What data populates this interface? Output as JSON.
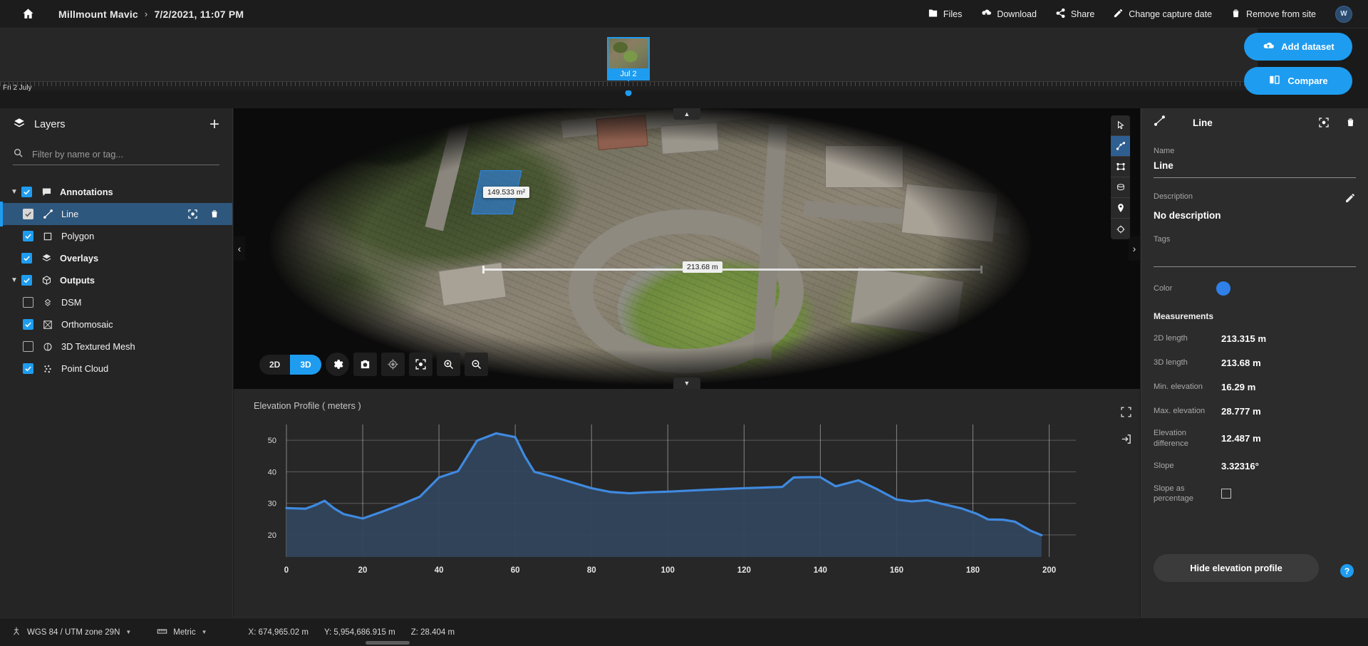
{
  "topbar": {
    "home_icon": "home-icon",
    "site_name": "Millmount Mavic",
    "separator": "›",
    "capture_date": "7/2/2021, 11:07 PM",
    "actions": [
      {
        "label": "Files",
        "icon": "folder-icon"
      },
      {
        "label": "Download",
        "icon": "cloud-download-icon"
      },
      {
        "label": "Share",
        "icon": "share-icon"
      },
      {
        "label": "Change capture date",
        "icon": "pencil-icon"
      },
      {
        "label": "Remove from site",
        "icon": "trash-icon"
      }
    ],
    "avatar_initial": "W"
  },
  "side_actions": {
    "add_dataset": "Add dataset",
    "compare": "Compare"
  },
  "timeline": {
    "range_label": "Fri 2 July",
    "datasets": [
      {
        "label": "Jul 2",
        "selected": true
      }
    ]
  },
  "sidebar": {
    "title": "Layers",
    "add_label": "+",
    "search_placeholder": "Filter by name or tag...",
    "search_value": "",
    "items": [
      {
        "label": "Annotations",
        "icon": "annotation-icon",
        "checked": true,
        "expandable": true,
        "expanded": true,
        "indent": 0,
        "bold": true
      },
      {
        "label": "Line",
        "icon": "line-icon",
        "checked": true,
        "expandable": false,
        "indent": 2,
        "selected": true,
        "bold": false,
        "actions": [
          "focus-icon",
          "trash-icon"
        ]
      },
      {
        "label": "Polygon",
        "icon": "polygon-icon",
        "checked": true,
        "expandable": false,
        "indent": 2,
        "bold": false
      },
      {
        "label": "Overlays",
        "icon": "layers-icon",
        "checked": true,
        "expandable": false,
        "indent": 1,
        "bold": true
      },
      {
        "label": "Outputs",
        "icon": "cube-icon",
        "checked": true,
        "expandable": true,
        "expanded": true,
        "indent": 0,
        "bold": true
      },
      {
        "label": "DSM",
        "icon": "dsm-icon",
        "checked": false,
        "expandable": false,
        "indent": 2,
        "bold": false
      },
      {
        "label": "Orthomosaic",
        "icon": "ortho-icon",
        "checked": true,
        "expandable": false,
        "indent": 2,
        "bold": false
      },
      {
        "label": "3D Textured Mesh",
        "icon": "mesh-icon",
        "checked": false,
        "expandable": false,
        "indent": 2,
        "bold": false
      },
      {
        "label": "Point Cloud",
        "icon": "pointcloud-icon",
        "checked": true,
        "expandable": false,
        "indent": 2,
        "bold": false
      }
    ]
  },
  "viewport": {
    "area_label": "149.533 m²",
    "distance_label": "213.68 m",
    "toolbar": {
      "mode_2d": "2D",
      "mode_3d": "3D",
      "active_mode": "3D",
      "buttons": [
        {
          "icon": "gear-icon"
        },
        {
          "icon": "camera-icon"
        },
        {
          "icon": "target-icon"
        },
        {
          "icon": "fit-view-icon"
        },
        {
          "icon": "zoom-in-icon"
        },
        {
          "icon": "zoom-out-icon"
        }
      ]
    },
    "tool_palette": [
      {
        "icon": "cursor-icon",
        "active": false
      },
      {
        "icon": "line-tool-icon",
        "active": true
      },
      {
        "icon": "polygon-tool-icon",
        "active": false
      },
      {
        "icon": "volume-tool-icon",
        "active": false
      },
      {
        "icon": "marker-tool-icon",
        "active": false
      },
      {
        "icon": "circle-tool-icon",
        "active": false
      }
    ]
  },
  "profile": {
    "title": "Elevation Profile ( meters )",
    "icons": [
      "expand-icon",
      "export-icon"
    ]
  },
  "chart_data": {
    "type": "area",
    "title": "Elevation Profile ( meters )",
    "xlabel": "",
    "ylabel": "",
    "xlim": [
      0,
      207
    ],
    "ylim": [
      13,
      55
    ],
    "xticks": [
      0,
      20,
      40,
      60,
      80,
      100,
      120,
      140,
      160,
      180,
      200
    ],
    "yticks": [
      20,
      30,
      40,
      50
    ],
    "grid": true,
    "legend": "none",
    "line_color": "#3f8ae0",
    "fill_color": "#32445c",
    "x": [
      0,
      2.5,
      5,
      7.5,
      10,
      12.5,
      15,
      17.5,
      20,
      25,
      30,
      35,
      40,
      45,
      50,
      55,
      60,
      62.5,
      65,
      70,
      75,
      80,
      85,
      90,
      95,
      100,
      110,
      120,
      125,
      130,
      133,
      137,
      140,
      144,
      150,
      155,
      160,
      164,
      168,
      172,
      177,
      181,
      184,
      188,
      191,
      195,
      198
    ],
    "y": [
      28.5,
      28.4,
      28.3,
      29.4,
      30.8,
      28.4,
      26.6,
      25.9,
      25.2,
      27.3,
      29.6,
      32.1,
      38.2,
      40.2,
      49.9,
      52.2,
      51.0,
      44.9,
      40.0,
      38.4,
      36.6,
      34.8,
      33.6,
      33.2,
      33.5,
      33.7,
      34.3,
      34.8,
      35.0,
      35.2,
      38.2,
      38.3,
      38.3,
      35.4,
      37.3,
      34.4,
      31.2,
      30.6,
      31.0,
      29.8,
      28.4,
      26.7,
      24.9,
      24.8,
      24.2,
      21.4,
      19.9
    ]
  },
  "right_panel": {
    "header_title": "Line",
    "header_icon": "line-icon",
    "header_actions": [
      "focus-icon",
      "trash-icon"
    ],
    "name_label": "Name",
    "name_value": "Line",
    "description_label": "Description",
    "description_value": "No description",
    "description_edit_icon": "pencil-icon",
    "tags_label": "Tags",
    "tags_value": "",
    "color_label": "Color",
    "color_value": "#2f80e8",
    "measurements_title": "Measurements",
    "measurements": [
      {
        "label": "2D length",
        "value": "213.315 m"
      },
      {
        "label": "3D length",
        "value": "213.68 m"
      },
      {
        "label": "Min. elevation",
        "value": "16.29 m"
      },
      {
        "label": "Max. elevation",
        "value": "28.777 m"
      },
      {
        "label": "Elevation difference",
        "value": "12.487 m"
      },
      {
        "label": "Slope",
        "value": "3.32316°"
      }
    ],
    "slope_pct_label": "Slope as percentage",
    "slope_pct_checked": false,
    "hide_profile_label": "Hide elevation profile",
    "help_label": "?"
  },
  "statusbar": {
    "crs": "WGS 84 / UTM zone 29N",
    "units": "Metric",
    "x": "X: 674,965.02 m",
    "y": "Y: 5,954,686.915 m",
    "z": "Z: 28.404 m"
  }
}
